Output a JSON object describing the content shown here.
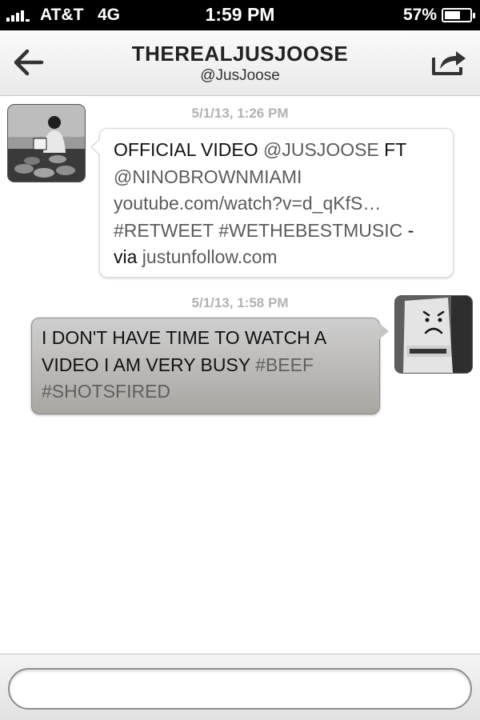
{
  "status_bar": {
    "carrier": "AT&T",
    "network": "4G",
    "time": "1:59 PM",
    "battery": "57%",
    "battery_level": 0.57,
    "signal_icon": "signal-bars-icon",
    "battery_icon": "battery-icon"
  },
  "nav": {
    "title": "THEREALJUSJOOSE",
    "subtitle": "@JusJoose",
    "back_icon": "back-arrow-icon",
    "share_icon": "share-icon"
  },
  "messages": [
    {
      "direction": "incoming",
      "timestamp": "5/1/13, 1:26 PM",
      "lines": [
        {
          "t1": "OFFICIAL VIDEO ",
          "m1": "@JUSJOOSE",
          "t2": " FT"
        },
        {
          "m1": "@NINOBROWNMIAMI"
        },
        {
          "u1": "youtube.com/watch?v=d_qKfS…"
        },
        {
          "h1": "#RETWEET",
          "t1": " ",
          "h2": "#WETHEBESTMUSIC",
          "t2": " -"
        },
        {
          "t1": "via ",
          "u1": "justunfollow.com"
        }
      ]
    },
    {
      "direction": "outgoing",
      "timestamp": "5/1/13, 1:58 PM",
      "lines": [
        {
          "t1": "I DON'T HAVE TIME TO WATCH A"
        },
        {
          "t1": "VIDEO I AM VERY BUSY ",
          "h1": "#BEEF"
        },
        {
          "h1": "#SHOTSFIRED"
        }
      ]
    }
  ],
  "compose": {
    "placeholder": "",
    "value": ""
  }
}
